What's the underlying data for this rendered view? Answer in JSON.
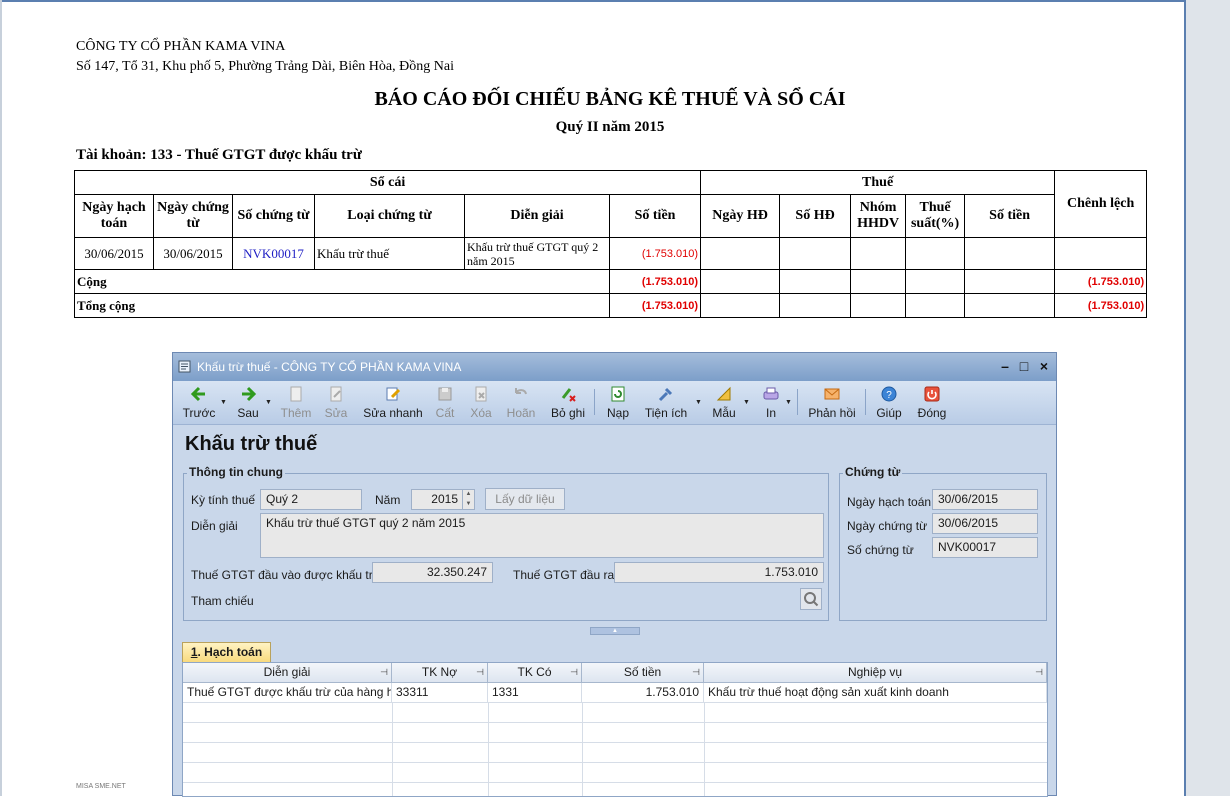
{
  "report": {
    "company": "CÔNG TY CỔ PHẦN KAMA VINA",
    "address": "Số 147, Tổ 31, Khu phố 5, Phường Trảng Dài, Biên Hòa, Đồng Nai",
    "title": "BÁO CÁO ĐỐI CHIẾU BẢNG KÊ THUẾ VÀ SỔ CÁI",
    "subtitle": "Quý II năm 2015",
    "account": "Tài khoản: 133 - Thuế GTGT được khấu trừ",
    "group_headers": {
      "so_cai": "Sổ cái",
      "thue": "Thuế",
      "chenh_lech": "Chênh lệch"
    },
    "columns": {
      "ngay_hach_toan": "Ngày hạch toán",
      "ngay_chung_tu": "Ngày chứng từ",
      "so_chung_tu": "Số chứng từ",
      "loai_chung_tu": "Loại chứng từ",
      "dien_giai": "Diễn giải",
      "so_tien": "Số tiền",
      "ngay_hd": "Ngày HĐ",
      "so_hd": "Số HĐ",
      "nhom_hhdv": "Nhóm HHDV",
      "thue_suat": "Thuế suất(%)",
      "so_tien_thue": "Số tiền"
    },
    "row": {
      "ngay_hach_toan": "30/06/2015",
      "ngay_chung_tu": "30/06/2015",
      "so_chung_tu": "NVK00017",
      "loai_chung_tu": "Khấu trừ thuế",
      "dien_giai": "Khấu trừ thuế GTGT quý 2 năm 2015",
      "so_tien": "(1.753.010)"
    },
    "cong": {
      "label": "Cộng",
      "so_tien": "(1.753.010)",
      "chenh_lech": "(1.753.010)"
    },
    "tong_cong": {
      "label": "Tổng cộng",
      "so_tien": "(1.753.010)",
      "chenh_lech": "(1.753.010)"
    },
    "watermark": "MISA SME.NET"
  },
  "dialog": {
    "window_title": "Khấu trừ thuế - CÔNG TY CỔ PHẦN KAMA VINA",
    "toolbar": {
      "back": "Trước",
      "next": "Sau",
      "add": "Thêm",
      "edit": "Sửa",
      "quick_edit": "Sửa nhanh",
      "save": "Cất",
      "delete": "Xóa",
      "undo": "Hoãn",
      "unpost": "Bỏ ghi",
      "reload": "Nạp",
      "utilities": "Tiện ích",
      "template": "Mẫu",
      "print": "In",
      "feedback": "Phản hồi",
      "help": "Giúp",
      "close": "Đóng"
    },
    "form_title": "Khấu trừ thuế",
    "general": {
      "group_label": "Thông tin chung",
      "period_label": "Kỳ tính thuế",
      "period_value": "Quý 2",
      "year_label": "Năm",
      "year_value": "2015",
      "fetch_button": "Lấy dữ liệu",
      "desc_label": "Diễn giải",
      "desc_value": "Khấu trừ thuế GTGT quý 2 năm 2015",
      "input_vat_label": "Thuế GTGT đầu vào được khấu trừ",
      "input_vat_value": "32.350.247",
      "output_vat_label": "Thuế GTGT đầu ra",
      "output_vat_value": "1.753.010",
      "reference_label": "Tham chiếu"
    },
    "voucher": {
      "group_label": "Chứng từ",
      "posting_date_label": "Ngày hạch toán",
      "posting_date_value": "30/06/2015",
      "voucher_date_label": "Ngày chứng từ",
      "voucher_date_value": "30/06/2015",
      "voucher_no_label": "Số chứng từ",
      "voucher_no_value": "NVK00017"
    },
    "tab": {
      "number": "1",
      "label": ". Hạch toán"
    },
    "grid": {
      "headers": [
        "Diễn giải",
        "TK Nợ",
        "TK Có",
        "Số tiền",
        "Nghiệp vụ"
      ],
      "rows": [
        [
          "Thuế GTGT được khấu trừ của hàng hó",
          "33311",
          "1331",
          "1.753.010",
          "Khấu trừ thuế hoạt động sản xuất kinh doanh"
        ]
      ]
    }
  }
}
